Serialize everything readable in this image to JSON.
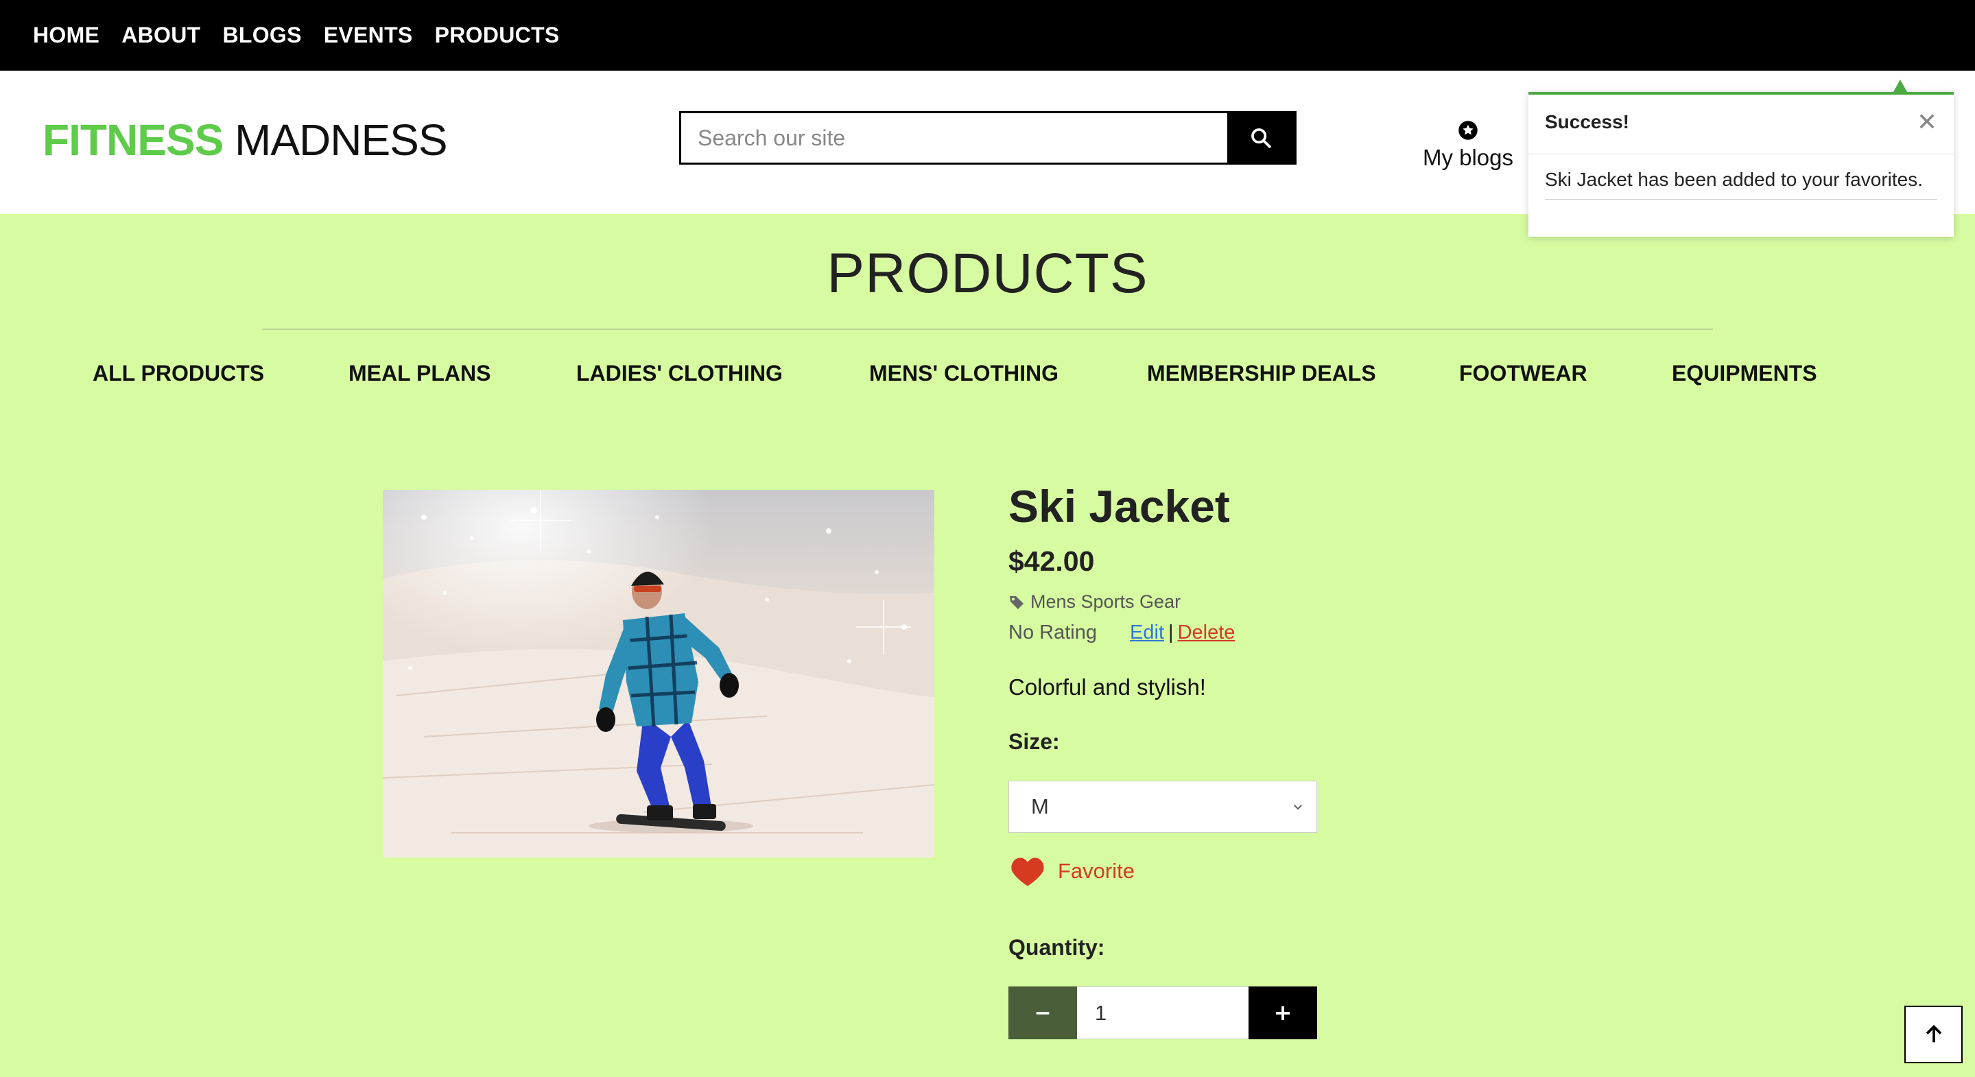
{
  "topnav": {
    "items": [
      "HOME",
      "ABOUT",
      "BLOGS",
      "EVENTS",
      "PRODUCTS"
    ]
  },
  "header": {
    "logo_accent": "FITNESS",
    "logo_main": "MADNESS",
    "search_placeholder": "Search our site",
    "my_blogs_label": "My blogs",
    "accent_color": "#5ecb4b"
  },
  "toast": {
    "title": "Success!",
    "message": "Ski Jacket has been added to your favorites.",
    "close_glyph": "✕"
  },
  "products": {
    "title": "PRODUCTS",
    "categories": [
      "ALL PRODUCTS",
      "MEAL PLANS",
      "LADIES' CLOTHING",
      "MENS' CLOTHING",
      "MEMBERSHIP DEALS",
      "FOOTWEAR",
      "EQUIPMENTS"
    ]
  },
  "product": {
    "name": "Ski Jacket",
    "price": "$42.00",
    "category": "Mens Sports Gear",
    "rating": "No Rating",
    "edit_label": "Edit",
    "separator": "|",
    "delete_label": "Delete",
    "description": "Colorful and stylish!",
    "size_label": "Size:",
    "size_value": "M",
    "favorite_label": "Favorite",
    "quantity_label": "Quantity:",
    "quantity_value": "1",
    "image_icon": "snowboarder-photo"
  },
  "colors": {
    "background": "#d7fba1",
    "favorite": "#d63a1f",
    "edit_link": "#2f78d6",
    "delete_link": "#d23b2a",
    "toast_border": "#4caa45"
  }
}
